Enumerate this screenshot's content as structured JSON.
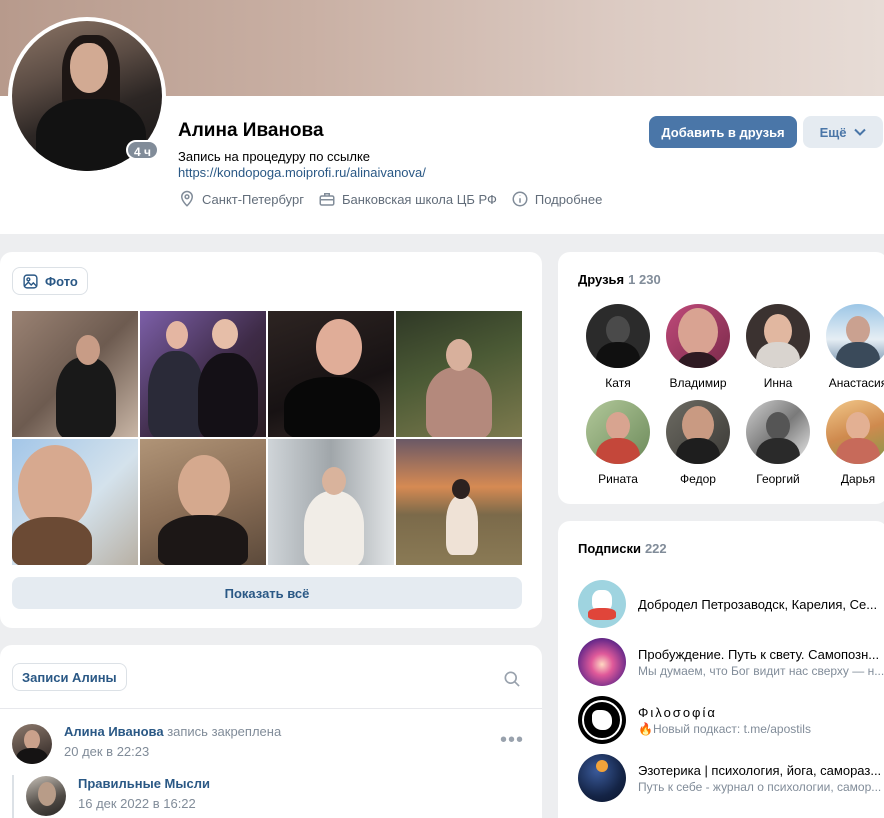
{
  "profile": {
    "name": "Алина Иванова",
    "online_badge": "4 ч",
    "status_text": "Запись на процедуру по ссылке ",
    "status_link": "https://kondopoga.moiprofi.ru/alinaivanova/",
    "city": "Санкт-Петербург",
    "work": "Банковская школа ЦБ РФ",
    "more": "Подробнее",
    "add_friend_label": "Добавить в друзья",
    "more_button_label": "Ещё"
  },
  "photos": {
    "tab_label": "Фото",
    "show_all_label": "Показать всё"
  },
  "friends": {
    "title": "Друзья",
    "count": "1 230",
    "items": [
      {
        "name": "Катя"
      },
      {
        "name": "Владимир"
      },
      {
        "name": "Инна"
      },
      {
        "name": "Анастасия"
      },
      {
        "name": "Рината"
      },
      {
        "name": "Федор"
      },
      {
        "name": "Георгий"
      },
      {
        "name": "Дарья"
      }
    ]
  },
  "subscriptions": {
    "title": "Подписки",
    "count": "222",
    "items": [
      {
        "name": "Добродел Петрозаводск, Карелия, Се...",
        "desc": ""
      },
      {
        "name": "Пробуждение. Путь к свету. Самопозн...",
        "desc": "Мы думаем, что Бог видит нас сверху — н..."
      },
      {
        "name": "Φιλοσοφία",
        "desc": "🔥Новый подкаст: t.me/apostils"
      },
      {
        "name": "Эзотерика | психология, йога, самораз...",
        "desc": "Путь к себе - журнал о психологии, самор..."
      }
    ]
  },
  "posts": {
    "tab_label": "Записи Алины",
    "pinned_post": {
      "author": "Алина Иванова",
      "pinned_note": " запись закреплена",
      "date": "20 дек в 22:23"
    },
    "repost": {
      "author": "Правильные Мысли",
      "date": "16 дек 2022 в 16:22"
    }
  },
  "colors": {
    "accent": "#4a76a8",
    "link": "#2a5885",
    "muted": "#818c99",
    "background": "#edeef0"
  }
}
